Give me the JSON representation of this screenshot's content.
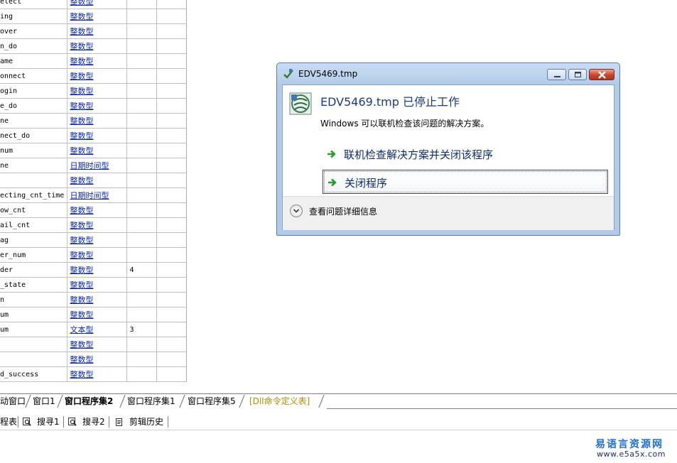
{
  "variables": [
    {
      "name": "elect",
      "type": "整数型",
      "col3": "",
      "col4": ""
    },
    {
      "name": "ing",
      "type": "整数型",
      "col3": "",
      "col4": ""
    },
    {
      "name": "over",
      "type": "整数型",
      "col3": "",
      "col4": ""
    },
    {
      "name": "n_do",
      "type": "整数型",
      "col3": "",
      "col4": ""
    },
    {
      "name": "ame",
      "type": "整数型",
      "col3": "",
      "col4": ""
    },
    {
      "name": "onnect",
      "type": "整数型",
      "col3": "",
      "col4": ""
    },
    {
      "name": "ogin",
      "type": "整数型",
      "col3": "",
      "col4": ""
    },
    {
      "name": "e_do",
      "type": "整数型",
      "col3": "",
      "col4": ""
    },
    {
      "name": "ne",
      "type": "整数型",
      "col3": "",
      "col4": ""
    },
    {
      "name": "nect_do",
      "type": "整数型",
      "col3": "",
      "col4": ""
    },
    {
      "name": "num",
      "type": "整数型",
      "col3": "",
      "col4": ""
    },
    {
      "name": "ne",
      "type": "日期时间型",
      "col3": "",
      "col4": ""
    },
    {
      "name": "",
      "type": "整数型",
      "col3": "",
      "col4": ""
    },
    {
      "name": "ecting_cnt_time",
      "type": "日期时间型",
      "col3": "",
      "col4": ""
    },
    {
      "name": "ow_cnt",
      "type": "整数型",
      "col3": "",
      "col4": ""
    },
    {
      "name": "ail_cnt",
      "type": "整数型",
      "col3": "",
      "col4": ""
    },
    {
      "name": "ag",
      "type": "整数型",
      "col3": "",
      "col4": ""
    },
    {
      "name": "er_num",
      "type": "整数型",
      "col3": "",
      "col4": ""
    },
    {
      "name": "der",
      "type": "整数型",
      "col3": "4",
      "col4": ""
    },
    {
      "name": "_state",
      "type": "整数型",
      "col3": "",
      "col4": ""
    },
    {
      "name": "n",
      "type": "整数型",
      "col3": "",
      "col4": ""
    },
    {
      "name": "um",
      "type": "整数型",
      "col3": "",
      "col4": ""
    },
    {
      "name": "um",
      "type": "文本型",
      "col3": "3",
      "col4": ""
    },
    {
      "name": "",
      "type": "整数型",
      "col3": "",
      "col4": ""
    },
    {
      "name": "",
      "type": "整数型",
      "col3": "",
      "col4": ""
    },
    {
      "name": "d_success",
      "type": "整数型",
      "col3": "",
      "col4": ""
    }
  ],
  "tabs": [
    {
      "label": "动窗口"
    },
    {
      "label": "窗口1"
    },
    {
      "label": "窗口程序集2"
    },
    {
      "label": "窗口程序集1"
    },
    {
      "label": "窗口程序集5"
    },
    {
      "label": "[Dll命令定义表]"
    }
  ],
  "toolbar": {
    "items": [
      {
        "label": "程表"
      },
      {
        "label": "搜寻1"
      },
      {
        "label": "搜寻2"
      },
      {
        "label": "剪辑历史"
      }
    ]
  },
  "watermark": {
    "title": "易语言资源网",
    "url": "www.e5a5x.com"
  },
  "dialog": {
    "title": "EDV5469.tmp",
    "heading": "EDV5469.tmp 已停止工作",
    "message": "Windows 可以联机检查该问题的解决方案。",
    "option_check": "联机检查解决方案并关闭该程序",
    "option_close": "关闭程序",
    "details": "查看问题详细信息"
  },
  "colors": {
    "type_link": "#0b28b0",
    "dialog_heading": "#1a3a8c",
    "option_text": "#0e2b6e",
    "arrow_green": "#2e9b2e",
    "watermark": "#1f6fd0"
  }
}
